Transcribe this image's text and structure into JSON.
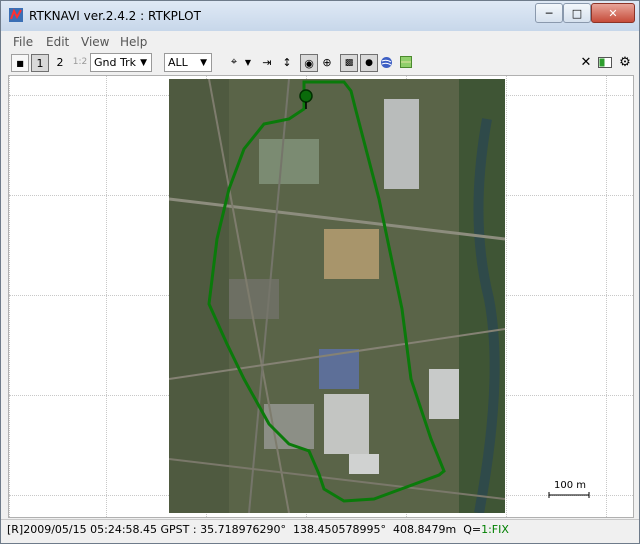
{
  "window": {
    "title": "RTKNAVI ver.2.4.2 : RTKPLOT"
  },
  "menu": {
    "items": [
      "File",
      "Edit",
      "View",
      "Help"
    ]
  },
  "toolbar": {
    "btn1": "1",
    "btn2": "2",
    "btn12": "1:2",
    "plot_type": "Gnd Trk",
    "sat_filter": "ALL"
  },
  "scale": {
    "label": "100 m"
  },
  "status": {
    "text": "[R]2009/05/15 05:24:58.45 GPST : 35.718976290°  138.450578995°  408.8479m  Q=",
    "quality": "1:FIX"
  },
  "colors": {
    "track": "#0a7a0a",
    "fix": "#008000"
  }
}
